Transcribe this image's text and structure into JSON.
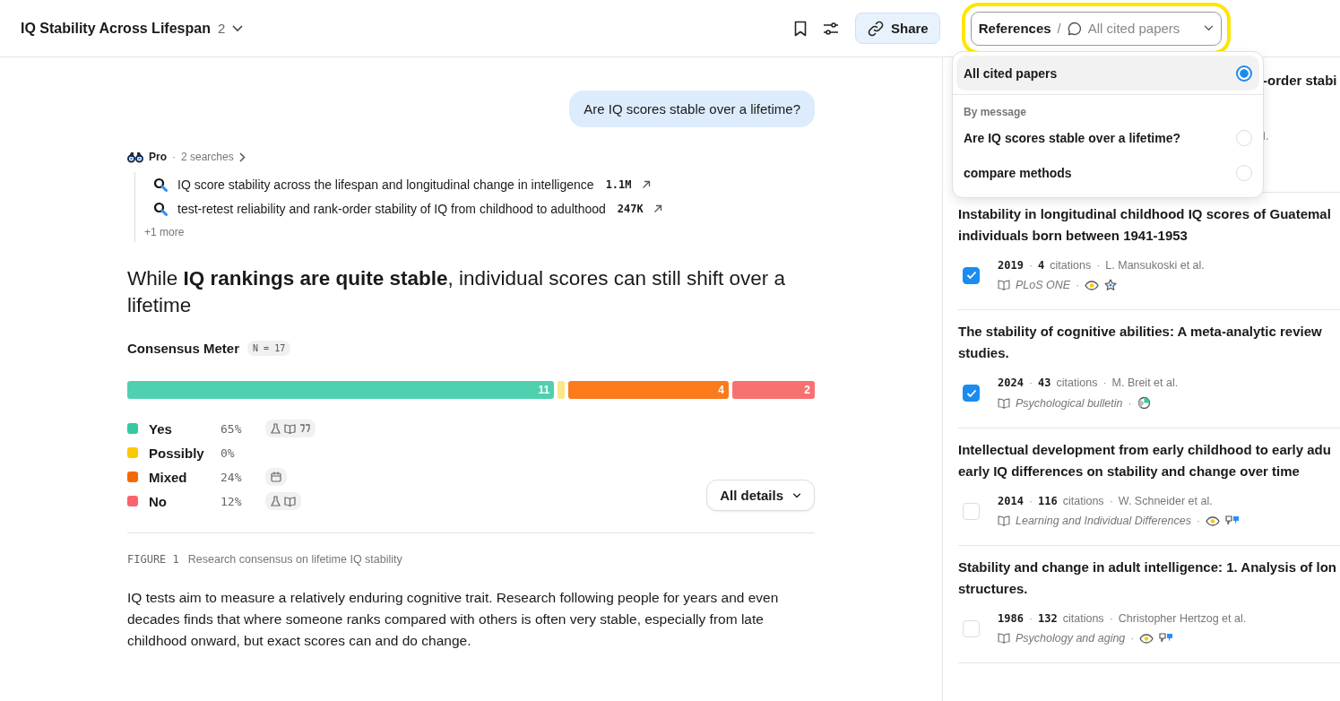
{
  "header": {
    "title": "IQ Stability Across Lifespan",
    "count": "2",
    "share": "Share",
    "references": {
      "label": "References",
      "separator": "/",
      "filter": "All cited papers"
    }
  },
  "dropdown": {
    "options": [
      {
        "label": "All cited papers",
        "selected": true
      }
    ],
    "section": "By message",
    "messages": [
      {
        "label": "Are IQ scores stable over a lifetime?",
        "selected": false
      },
      {
        "label": "compare methods",
        "selected": false
      }
    ]
  },
  "chat": {
    "question": "Are IQ scores stable over a lifetime?",
    "pro": {
      "label": "Pro",
      "separator": "·",
      "searches": "2 searches"
    },
    "queries": [
      {
        "text": "IQ score stability across the lifespan and longitudinal change in intelligence",
        "count": "1.1M"
      },
      {
        "text": "test-retest reliability and rank-order stability of IQ from childhood to adulthood",
        "count": "247K"
      }
    ],
    "more": "+1 more",
    "heading": "While **IQ rankings are quite stable**, individual scores can still shift over a lifetime",
    "consensus": {
      "title": "Consensus Meter",
      "n": "N = 17",
      "segments": [
        {
          "count": "11",
          "color": "#4fd1b0"
        },
        {
          "color": "#fde68a"
        },
        {
          "count": "4",
          "color": "#fb7a1c"
        },
        {
          "count": "2",
          "color": "#f87171"
        }
      ],
      "legend": [
        {
          "label": "Yes",
          "percent": "65%",
          "color": "#34c9a3",
          "sources": [
            {
              "kind": "flask"
            },
            {
              "kind": "book"
            },
            {
              "kind": "quote"
            }
          ]
        },
        {
          "label": "Possibly",
          "percent": "0%",
          "color": "#fcc800"
        },
        {
          "label": "Mixed",
          "percent": "24%",
          "color": "#f56a00",
          "sources": [
            {
              "kind": "calendar"
            }
          ]
        },
        {
          "label": "No",
          "percent": "12%",
          "color": "#f8646c",
          "sources": [
            {
              "kind": "flask"
            },
            {
              "kind": "book"
            }
          ]
        }
      ],
      "details": "All details"
    },
    "figure": {
      "label": "FIGURE 1",
      "caption": "Research consensus on lifetime IQ stability"
    },
    "paragraph": "IQ tests aim to measure a relatively enduring cognitive trait. Research following people for years and even decades finds that where someone ranks compared with others is often very stable, especially from late childhood onward, but exact scores can and do change."
  },
  "hidden_paper": {
    "title_tail": "-order stabi",
    "meta_tail": "l."
  },
  "papers": [
    {
      "title_lines": [
        "Instability in longitudinal childhood IQ scores of Guatemal",
        "individuals born between 1941-1953"
      ],
      "year": "2019",
      "separators": [
        "·",
        "·",
        "·"
      ],
      "citations": "4",
      "citations_label": "citations",
      "authors": "L. Mansukoski et al.",
      "journal": "PLoS ONE",
      "checked": true,
      "badges": [
        {
          "kind": "eye"
        },
        {
          "kind": "star"
        }
      ]
    },
    {
      "title_lines": [
        "The stability of cognitive abilities: A meta-analytic review",
        "studies."
      ],
      "year": "2024",
      "separators": [
        "·",
        "·",
        "·"
      ],
      "citations": "43",
      "citations_label": "citations",
      "authors": "M. Breit et al.",
      "journal": "Psychological bulletin",
      "checked": true,
      "badges": [
        {
          "kind": "pie"
        }
      ]
    },
    {
      "title_lines": [
        "Intellectual development from early childhood to early adu",
        "early IQ differences on stability and change over time"
      ],
      "year": "2014",
      "separators": [
        "·",
        "·",
        "·"
      ],
      "citations": "116",
      "citations_label": "citations",
      "authors": "W. Schneider et al.",
      "journal": "Learning and Individual Differences",
      "checked": false,
      "badges": [
        {
          "kind": "eye"
        },
        {
          "kind": "thumbs"
        }
      ]
    },
    {
      "title_lines": [
        "Stability and change in adult intelligence: 1. Analysis of lon",
        "structures."
      ],
      "year": "1986",
      "separators": [
        "·",
        "·",
        "·"
      ],
      "citations": "132",
      "citations_label": "citations",
      "authors": "Christopher Hertzog et al.",
      "journal": "Psychology and aging",
      "checked": false,
      "badges": [
        {
          "kind": "eye"
        },
        {
          "kind": "thumbs"
        }
      ]
    }
  ]
}
